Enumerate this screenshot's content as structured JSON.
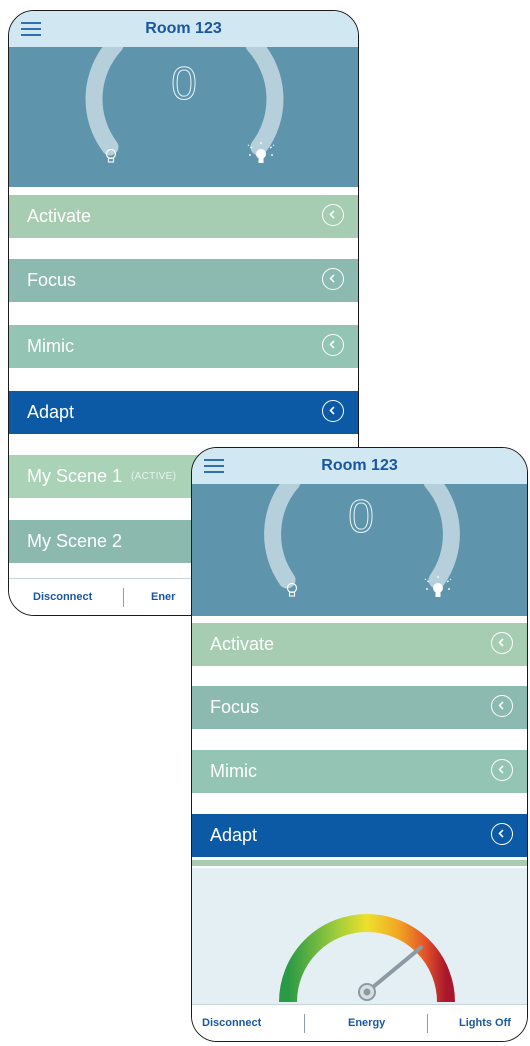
{
  "colors": {
    "header_bg": "#d1e7f1",
    "title": "#1a57a0",
    "dial_bg": "#5e95ac",
    "activate": "#a6cdb2",
    "focus": "#8cbab0",
    "mimic": "#93c4b4",
    "adapt_active": "#0c5aa6",
    "my_scene_1": "#a9d2b6",
    "my_scene_2": "#8bb9ae"
  },
  "back_screen": {
    "header": {
      "title": "Room 123",
      "menu_icon": "hamburger-menu-icon"
    },
    "dial": {
      "value": "0",
      "low_icon": "dim-bulb-icon",
      "high_icon": "bright-bulb-icon"
    },
    "scenes": [
      {
        "label": "Activate",
        "state": "normal"
      },
      {
        "label": "Focus",
        "state": "normal"
      },
      {
        "label": "Mimic",
        "state": "normal"
      },
      {
        "label": "Adapt",
        "state": "selected"
      },
      {
        "label": "My Scene 1",
        "tag": "(ACTIVE)",
        "state": "normal"
      },
      {
        "label": "My Scene 2",
        "state": "normal"
      }
    ],
    "footer": {
      "disconnect": "Disconnect",
      "energy": "Ener"
    }
  },
  "front_screen": {
    "header": {
      "title": "Room 123",
      "menu_icon": "hamburger-menu-icon"
    },
    "dial": {
      "value": "0",
      "low_icon": "dim-bulb-icon",
      "high_icon": "bright-bulb-icon"
    },
    "scenes": [
      {
        "label": "Activate",
        "state": "normal"
      },
      {
        "label": "Focus",
        "state": "normal"
      },
      {
        "label": "Mimic",
        "state": "normal"
      },
      {
        "label": "Adapt",
        "state": "selected"
      }
    ],
    "energy_gauge": {
      "icon": "energy-gauge-icon",
      "needle_level": 0.78
    },
    "footer": {
      "disconnect": "Disconnect",
      "energy": "Energy",
      "lights_off": "Lights Off"
    }
  }
}
